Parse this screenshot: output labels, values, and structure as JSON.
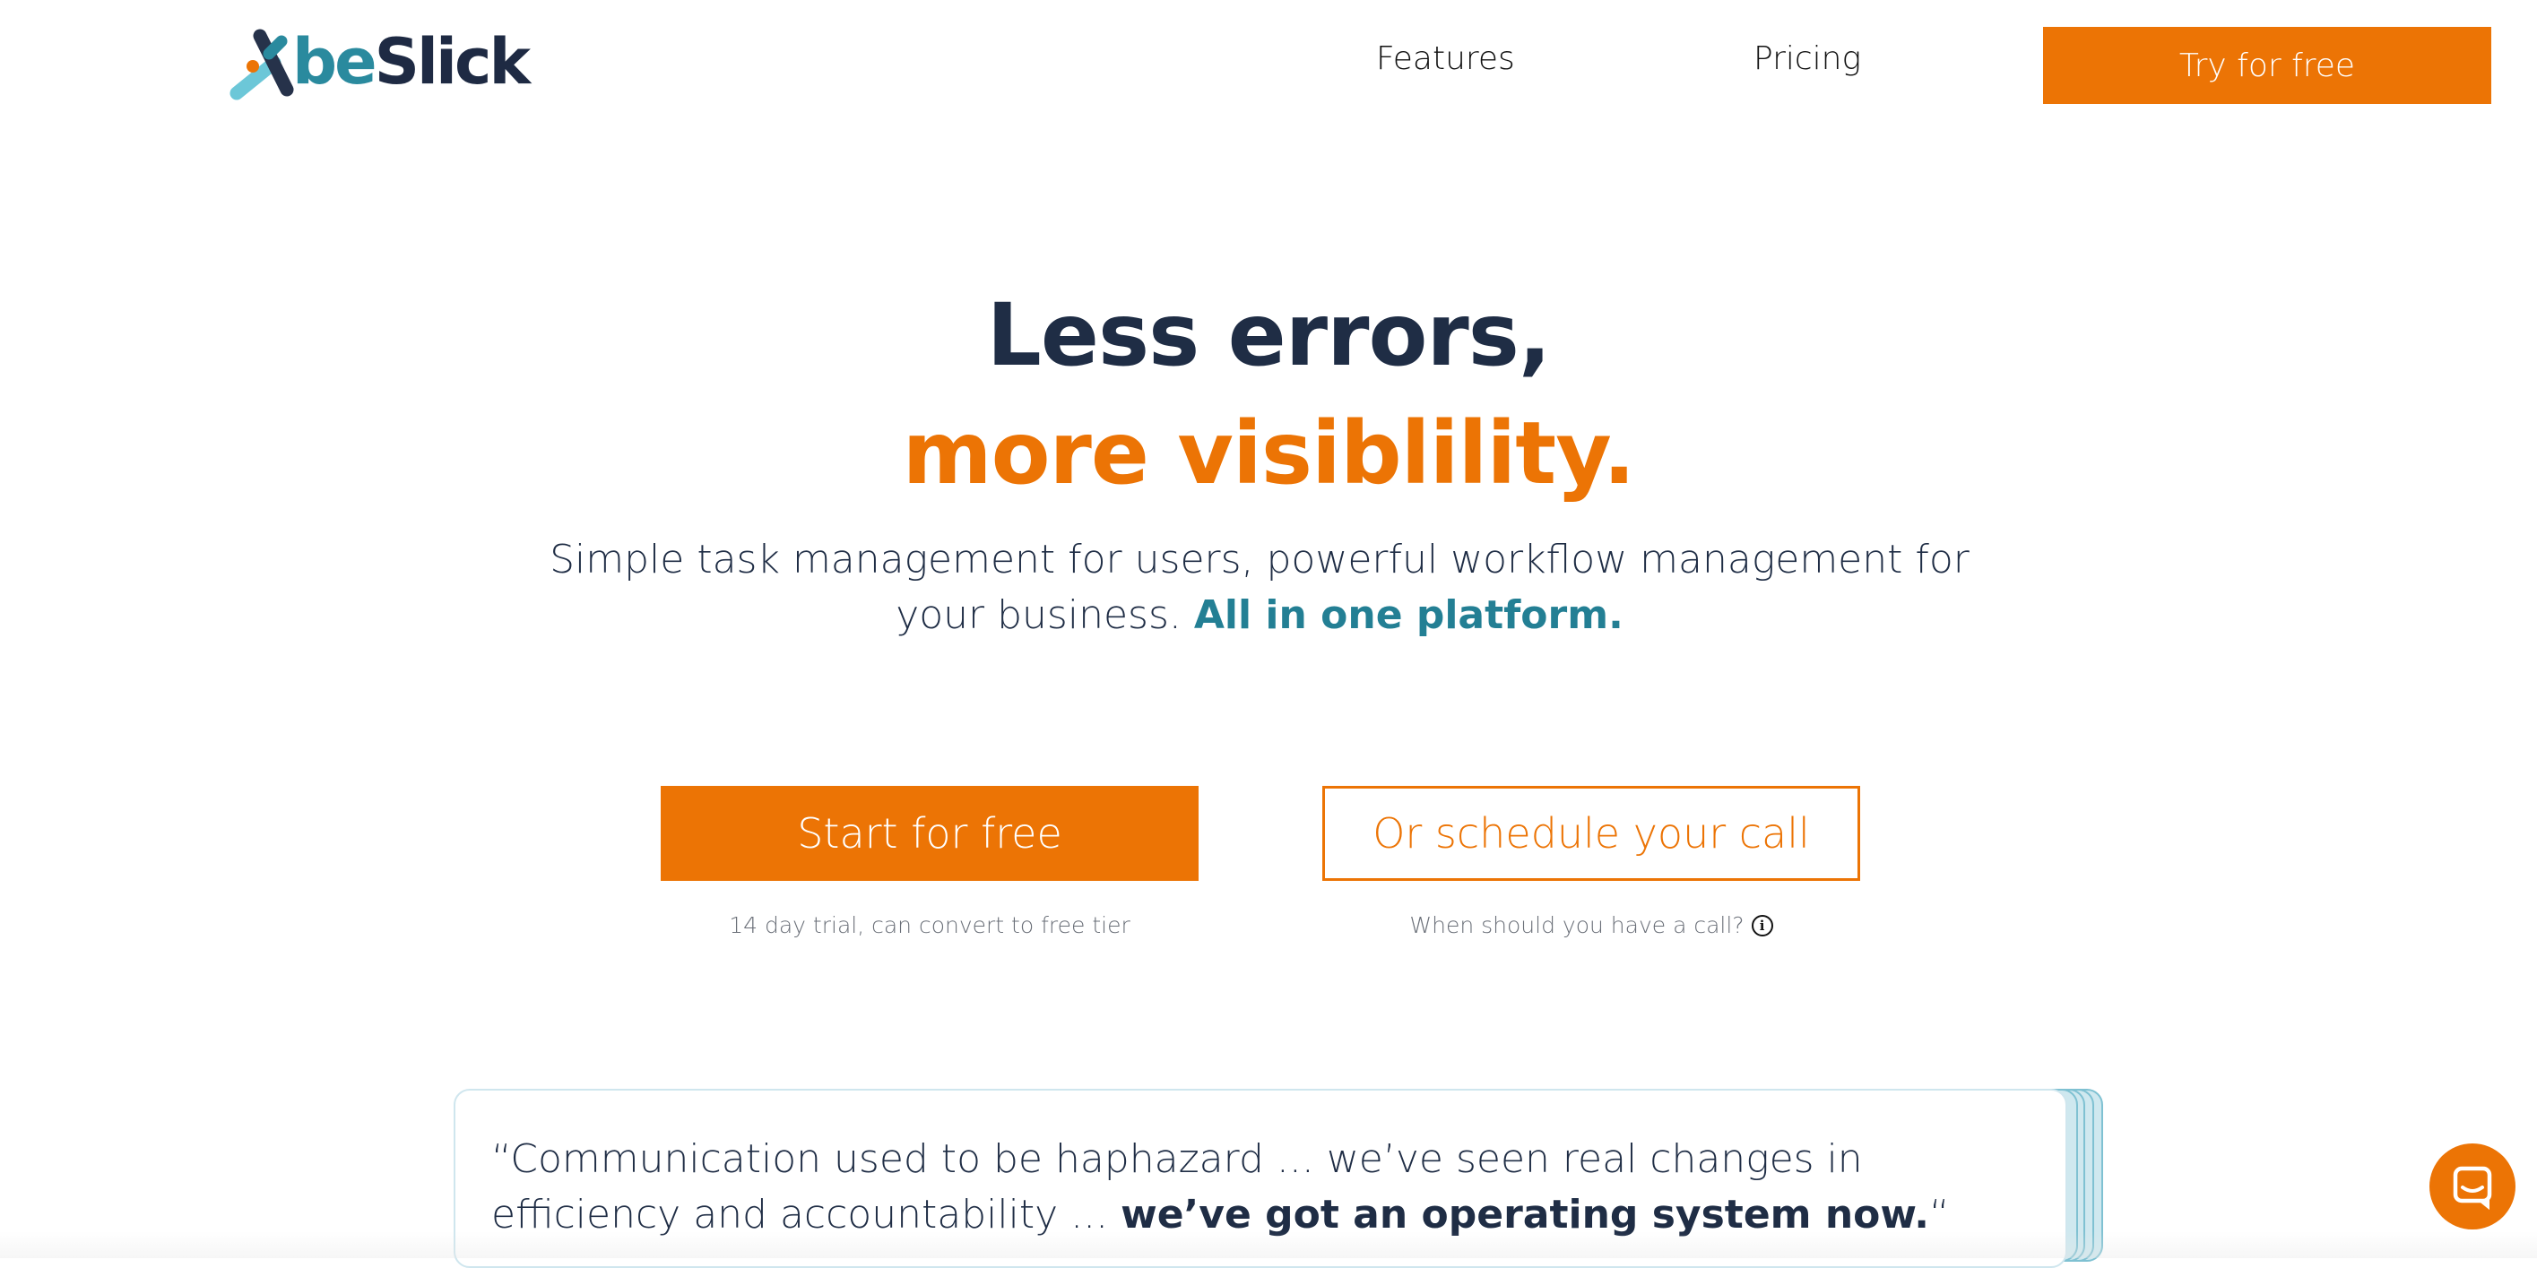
{
  "header": {
    "logo_text_be": "be",
    "logo_text_slick": "Slick",
    "nav": [
      {
        "label": "Features"
      },
      {
        "label": "Pricing"
      }
    ],
    "cta_label": "Try for free"
  },
  "hero": {
    "title_line1": "Less errors,",
    "title_line2": "more visiblility.",
    "subtitle": "Simple task management for users, powerful workflow management for your business.",
    "subtitle_highlight": "All in one platform.",
    "primary_cta": "Start for free",
    "secondary_cta": "Or schedule your call",
    "primary_note": "14 day trial, can convert to free tier",
    "secondary_note": "When should you have a call?"
  },
  "testimonial": {
    "quote": "“Communication used to be haphazard ... we’ve seen real changes in efficiency and accountability ...",
    "quote_strong": "we’ve got an operating system now.",
    "quote_close": "“"
  },
  "colors": {
    "brand_orange": "#ec7405",
    "brand_teal": "#237f94",
    "text_dark": "#1f2d45"
  },
  "icons": {
    "logo_mark": "x-logo-icon",
    "info": "info-icon",
    "chat": "chat-bubble-icon"
  }
}
